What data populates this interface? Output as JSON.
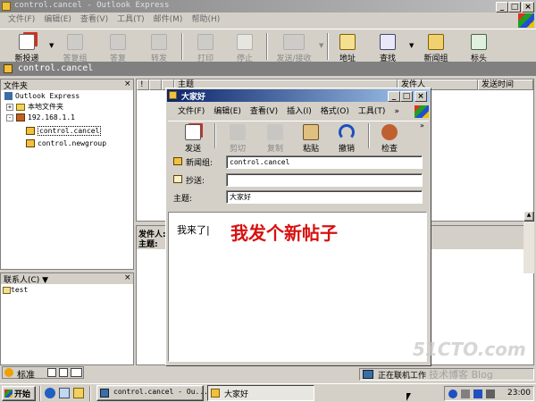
{
  "oe": {
    "title": "control.cancel - Outlook Express",
    "menu": [
      "文件(F)",
      "编辑(E)",
      "查看(V)",
      "工具(T)",
      "邮件(M)",
      "帮助(H)"
    ],
    "toolbar": [
      "新投递",
      "答复组",
      "答复",
      "转发",
      "打印",
      "停止",
      "发送/接收",
      "地址",
      "查找",
      "新闻组",
      "标头"
    ],
    "location": "control.cancel",
    "folders_header": "文件夹",
    "tree": {
      "root": "Outlook Express",
      "local": "本地文件夹",
      "server": "192.168.1.1",
      "group1": "control.cancel",
      "group2": "control.newgroup"
    },
    "list_headers": {
      "subject": "主题",
      "from": "发件人",
      "sent": "发送时间"
    },
    "preview": {
      "from": "发件人:",
      "subject": "主题:"
    },
    "contacts_header": "联系人(C) ▼",
    "contact": "test",
    "status": "正在联机工作"
  },
  "compose": {
    "title": "大家好",
    "menu": [
      "文件(F)",
      "编辑(E)",
      "查看(V)",
      "插入(I)",
      "格式(O)",
      "工具(T)",
      "»"
    ],
    "toolbar": [
      "发送",
      "剪切",
      "复制",
      "粘贴",
      "撤销",
      "检查"
    ],
    "newsgroup_label": "新闻组:",
    "newsgroup_value": "control.cancel",
    "cc_label": "抄送:",
    "cc_value": "",
    "subject_label": "主题:",
    "subject_value": "大家好",
    "body": "我来了|"
  },
  "overlay_text": "我发个新帖子",
  "ime": {
    "label": "标准"
  },
  "taskbar": {
    "start": "开始",
    "tasks": [
      "control.cancel - Ou...",
      "大家好"
    ],
    "clock": "23:00"
  },
  "watermark": {
    "site": "51CTO.com",
    "sub": "技术博客  Blog"
  }
}
